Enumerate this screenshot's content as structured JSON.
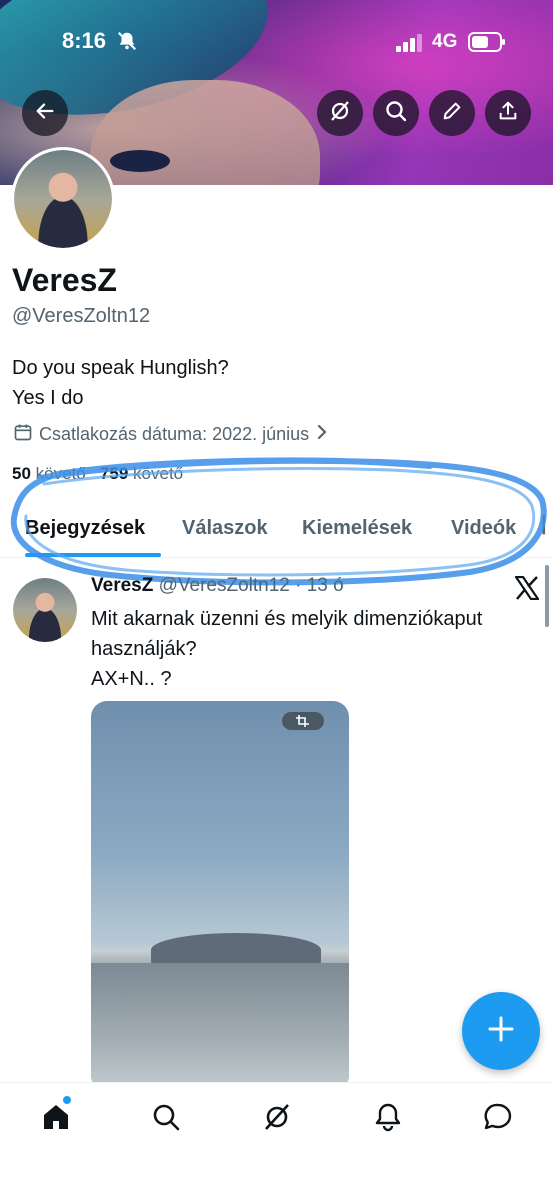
{
  "status_bar": {
    "time": "8:16",
    "network": "4G"
  },
  "header": {
    "icons": [
      "back-icon",
      "grok-icon",
      "search-icon",
      "edit-icon",
      "share-icon"
    ]
  },
  "profile": {
    "name": "VeresZ",
    "handle": "@VeresZoltn12",
    "bio_line1": "Do you speak Hunglish?",
    "bio_line2": "Yes I do",
    "joined": "Csatlakozás dátuma: 2022. június",
    "following_count": "50",
    "following_label": "követő",
    "followers_count": "759",
    "followers_label": "követő"
  },
  "tabs": [
    {
      "label": "Bejegyzések",
      "active": true
    },
    {
      "label": "Válaszok",
      "active": false
    },
    {
      "label": "Kiemelések",
      "active": false
    },
    {
      "label": "Videók",
      "active": false
    }
  ],
  "post": {
    "author_name": "VeresZ",
    "author_handle": "@VeresZoltn12 · 13 ó",
    "text_line1": "Mit akarnak üzenni és melyik dimenziókaput",
    "text_line2": "használják?",
    "text_line3": "AX+N.. ?"
  },
  "bottom_nav": [
    "home-icon",
    "search-icon",
    "grok-icon",
    "notifications-icon",
    "messages-icon"
  ],
  "colors": {
    "accent": "#1d9bf0",
    "text": "#0f1419",
    "secondary": "#536471",
    "scribble": "#3a8ee6"
  }
}
